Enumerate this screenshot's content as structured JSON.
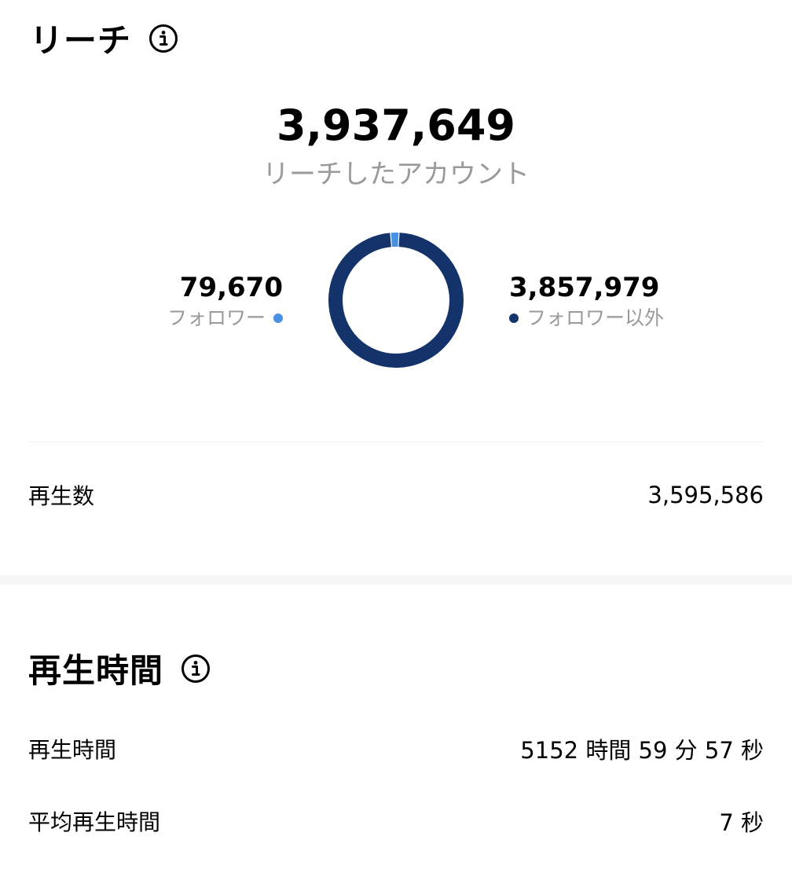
{
  "reach": {
    "title": "リーチ",
    "total": "3,937,649",
    "total_label": "リーチしたアカウント",
    "followers": {
      "value": "79,670",
      "label": "フォロワー",
      "color": "#4a90e2"
    },
    "non_followers": {
      "value": "3,857,979",
      "label": "フォロワー以外",
      "color": "#14336a"
    },
    "plays": {
      "label": "再生数",
      "value": "3,595,586"
    }
  },
  "chart_data": {
    "type": "pie",
    "categories": [
      "フォロワー",
      "フォロワー以外"
    ],
    "values": [
      79670,
      3857979
    ],
    "colors": [
      "#4a90e2",
      "#14336a"
    ],
    "title": ""
  },
  "watch_time": {
    "title": "再生時間",
    "rows": [
      {
        "label": "再生時間",
        "value": "5152 時間 59 分 57 秒"
      },
      {
        "label": "平均再生時間",
        "value": "7 秒"
      }
    ]
  },
  "icons": {
    "info": "info-icon"
  }
}
